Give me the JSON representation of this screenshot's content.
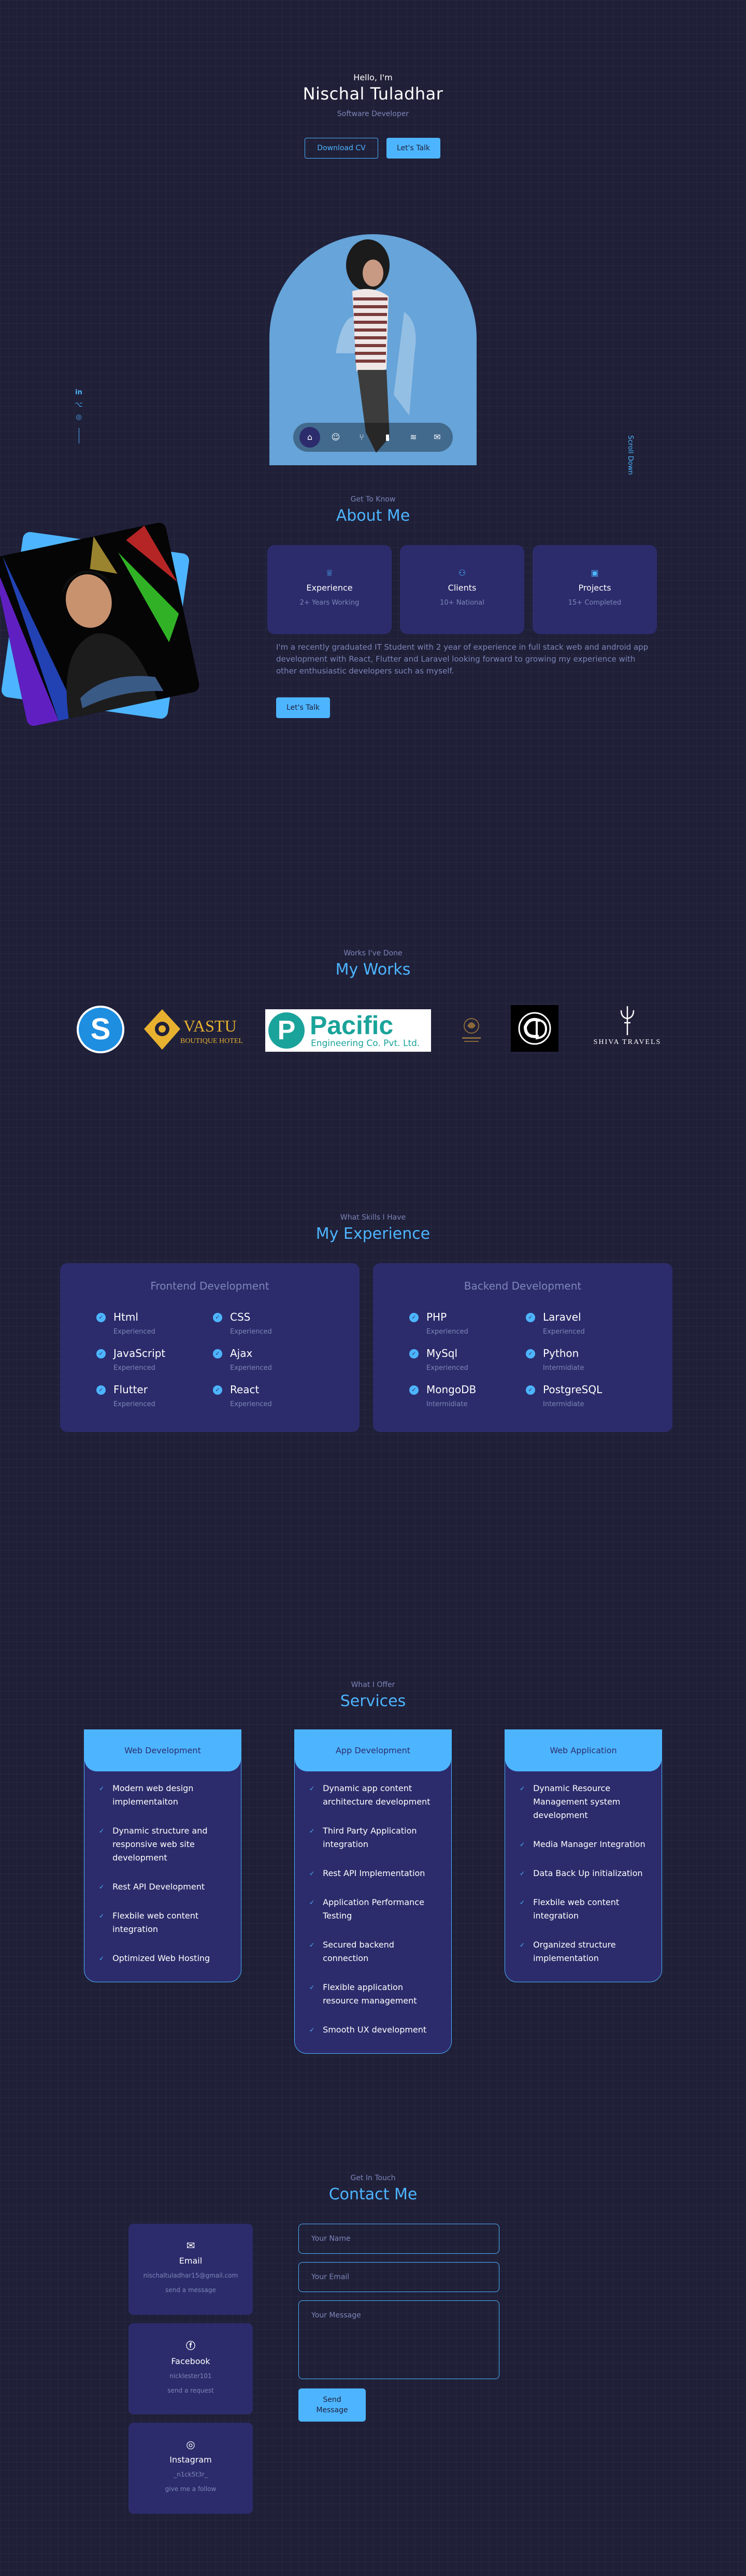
{
  "header": {
    "greeting": "Hello, I'm",
    "name": "Nischal Tuladhar",
    "role": "Software Developer",
    "download_cv": "Download CV",
    "lets_talk": "Let's Talk",
    "scroll_down": "Scroll Down"
  },
  "socials": [
    {
      "icon": "linkedin-icon",
      "glyph": "in"
    },
    {
      "icon": "github-icon",
      "glyph": "⌥"
    },
    {
      "icon": "dribbble-icon",
      "glyph": "◎"
    }
  ],
  "nav": [
    {
      "name": "home",
      "glyph": "⌂"
    },
    {
      "name": "about",
      "glyph": "☺"
    },
    {
      "name": "works",
      "glyph": "⑂"
    },
    {
      "name": "skills",
      "glyph": "▮"
    },
    {
      "name": "services",
      "glyph": "≋"
    },
    {
      "name": "contact",
      "glyph": "✉"
    }
  ],
  "about": {
    "eyebrow": "Get To Know",
    "title": "About Me",
    "cards": [
      {
        "icon": "award-icon",
        "title": "Experience",
        "sub": "2+ Years Working"
      },
      {
        "icon": "users-icon",
        "title": "Clients",
        "sub": "10+ National"
      },
      {
        "icon": "folder-icon",
        "title": "Projects",
        "sub": "15+ Completed"
      }
    ],
    "text": "I'm a recently graduated IT Student with 2 year of experience in full stack web and android app development with React, Flutter and Laravel looking forward to growing my experience with other enthusiastic developers such as myself.",
    "button": "Let's Talk"
  },
  "works": {
    "eyebrow": "Works I've Done",
    "title": "My Works",
    "logos": {
      "vastu_title": "VASTU",
      "vastu_sub": "BOUTIQUE HOTEL",
      "pacific_title": "Pacific",
      "pacific_sub": "Engineering Co. Pvt. Ltd.",
      "shiva": "SHIVA TRAVELS"
    }
  },
  "experience": {
    "eyebrow": "What Skills I Have",
    "title": "My Experience",
    "frontend": {
      "title": "Frontend Development",
      "skills": [
        {
          "name": "Html",
          "level": "Experienced"
        },
        {
          "name": "CSS",
          "level": "Experienced"
        },
        {
          "name": "JavaScript",
          "level": "Experienced"
        },
        {
          "name": "Ajax",
          "level": "Experienced"
        },
        {
          "name": "Flutter",
          "level": "Experienced"
        },
        {
          "name": "React",
          "level": "Experienced"
        }
      ]
    },
    "backend": {
      "title": "Backend Development",
      "skills": [
        {
          "name": "PHP",
          "level": "Experienced"
        },
        {
          "name": "Laravel",
          "level": "Experienced"
        },
        {
          "name": "MySql",
          "level": "Experienced"
        },
        {
          "name": "Python",
          "level": "Intermidiate"
        },
        {
          "name": "MongoDB",
          "level": "Intermidiate"
        },
        {
          "name": "PostgreSQL",
          "level": "Intermidiate"
        }
      ]
    }
  },
  "services": {
    "eyebrow": "What I Offer",
    "title": "Services",
    "cards": [
      {
        "title": "Web Development",
        "items": [
          "Modern web design implementaiton",
          "Dynamic structure and responsive web site development",
          "Rest API Development",
          "Flexbile web content integration",
          "Optimized Web Hosting"
        ]
      },
      {
        "title": "App Development",
        "items": [
          "Dynamic app content architecture development",
          "Third Party Application integration",
          "Rest API Implementation",
          "Application Performance Testing",
          "Secured backend connection",
          "Flexible application resource management",
          "Smooth UX development"
        ]
      },
      {
        "title": "Web Application",
        "items": [
          "Dynamic Resource Management system development",
          "Media Manager Integration",
          "Data Back Up initialization",
          "Flexbile web content integration",
          "Organized structure implementation"
        ]
      }
    ]
  },
  "contact": {
    "eyebrow": "Get In Touch",
    "title": "Contact Me",
    "options": [
      {
        "icon": "mail-icon",
        "glyph": "✉",
        "title": "Email",
        "value": "nischaltuladhar15@gmail.com",
        "link": "send a message"
      },
      {
        "icon": "facebook-icon",
        "glyph": "f",
        "title": "Facebook",
        "value": "nicklester101",
        "link": "send a request"
      },
      {
        "icon": "instagram-icon",
        "glyph": "◎",
        "title": "Instagram",
        "value": "_n1ck5t3r_",
        "link": "give me a follow"
      }
    ],
    "name_placeholder": "Your Name",
    "email_placeholder": "Your Email",
    "message_placeholder": "Your Message",
    "send": "Send Message"
  },
  "colors": {
    "bg": "#1f1f38",
    "card": "#2c2c6c",
    "primary": "#4db5ff",
    "muted": "#7d86b8"
  }
}
